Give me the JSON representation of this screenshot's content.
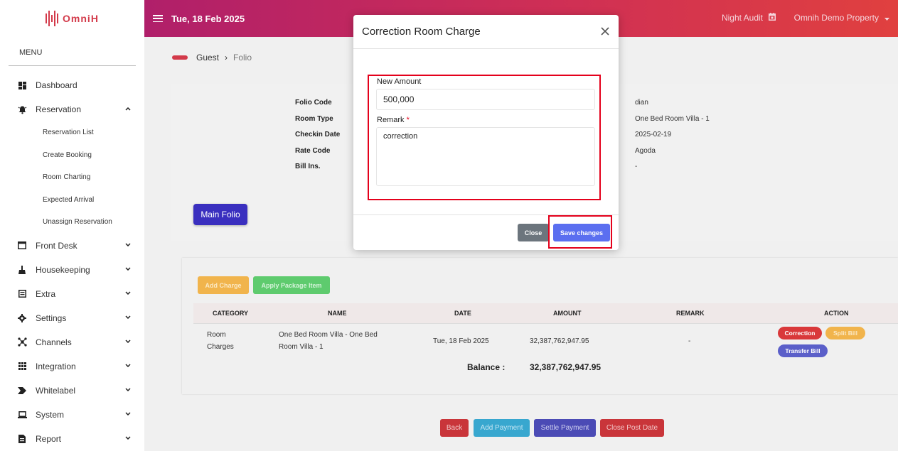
{
  "app": {
    "logo_text": "OmniH",
    "date": "Tue, 18 Feb 2025",
    "night_audit_label": "Night Audit",
    "property_label": "Omnih Demo Property"
  },
  "sidebar": {
    "menu_title": "MENU",
    "items": [
      {
        "label": "Dashboard",
        "icon": "dashboard-icon"
      },
      {
        "label": "Reservation",
        "icon": "bell-icon",
        "expanded": true
      },
      {
        "label": "Front Desk",
        "icon": "window-icon"
      },
      {
        "label": "Housekeeping",
        "icon": "broom-icon"
      },
      {
        "label": "Extra",
        "icon": "list-icon"
      },
      {
        "label": "Settings",
        "icon": "gear-icon"
      },
      {
        "label": "Channels",
        "icon": "network-icon"
      },
      {
        "label": "Integration",
        "icon": "grid-icon"
      },
      {
        "label": "Whitelabel",
        "icon": "tag-icon"
      },
      {
        "label": "System",
        "icon": "laptop-icon"
      },
      {
        "label": "Report",
        "icon": "report-icon"
      }
    ],
    "reservation_sub": [
      "Reservation List",
      "Create Booking",
      "Room Charting",
      "Expected Arrival",
      "Unassign Reservation"
    ]
  },
  "breadcrumb": {
    "parent": "Guest",
    "separator": "›",
    "current": "Folio"
  },
  "folio_info": {
    "labels": [
      "Folio Code",
      "Room Type",
      "Checkin Date",
      "Rate Code",
      "Bill Ins."
    ],
    "values": [
      "dian",
      "One Bed Room Villa - 1",
      "2025-02-19",
      "Agoda",
      "-"
    ]
  },
  "main_folio_label": "Main Folio",
  "charges": {
    "add_charge_label": "Add Charge",
    "apply_package_label": "Apply Package Item",
    "columns": [
      "CATEGORY",
      "NAME",
      "DATE",
      "AMOUNT",
      "REMARK",
      "ACTION"
    ],
    "row": {
      "category_line1": "Room",
      "category_line2": "Charges",
      "name_line1": "One Bed Room Villa - One Bed",
      "name_line2": "Room Villa - 1",
      "date": "Tue, 18 Feb 2025",
      "amount": "32,387,762,947.95",
      "remark": "-",
      "actions": [
        "Correction",
        "Split Bill",
        "Transfer Bill"
      ]
    },
    "balance_label": "Balance :",
    "balance_value": "32,387,762,947.95"
  },
  "footer_buttons": [
    "Back",
    "Add Payment",
    "Settle Payment",
    "Close Post Date"
  ],
  "modal": {
    "title": "Correction Room Charge",
    "new_amount_label": "New Amount",
    "new_amount_value": "500,000",
    "remark_label": "Remark",
    "required_mark": "*",
    "remark_value": "correction",
    "close_label": "Close",
    "save_label": "Save changes"
  },
  "colors": {
    "brand": "#d33a4a",
    "highlight": "#e4001b",
    "primary": "#5b6ff0"
  }
}
